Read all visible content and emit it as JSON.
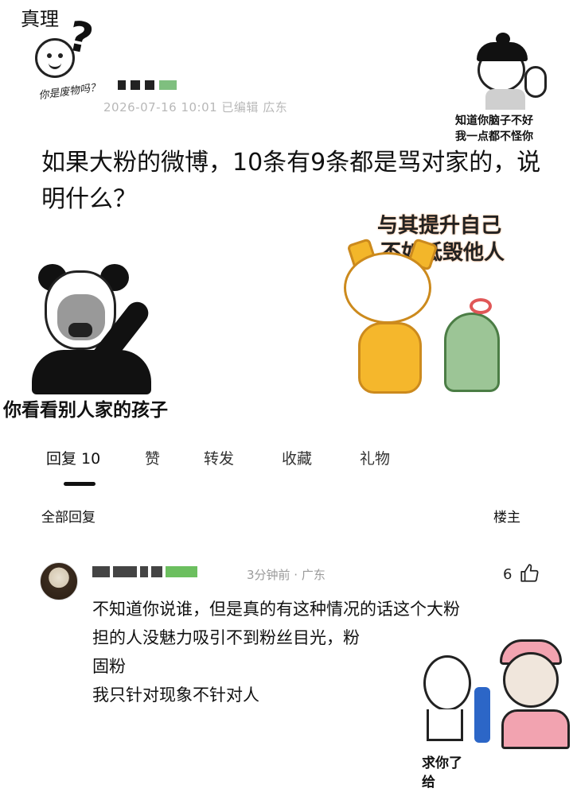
{
  "memes": {
    "top_left_title": "真理",
    "top_left_caption": "你是废物吗？",
    "top_right_caption": [
      "知道你脑子不好",
      "我一点都不怪你"
    ],
    "panda_caption": "你看看别人家的孩子",
    "cat_caption": [
      "与其提升自己",
      "不如诋毁他人"
    ],
    "bottom_right_caption": [
      "求你了",
      "给"
    ]
  },
  "post": {
    "meta": "2026-07-16 10:01 已编辑 広东",
    "body": "如果大粉的微博，10条有9条都是骂对家的，说明什么？"
  },
  "tabs": [
    {
      "label": "回复 10"
    },
    {
      "label": "赞"
    },
    {
      "label": "转发"
    },
    {
      "label": "收藏"
    },
    {
      "label": "礼物"
    }
  ],
  "filter": {
    "all_replies": "全部回复",
    "op": "楼主"
  },
  "comment": {
    "meta": "3分钟前 · 广东",
    "likes": "6",
    "lines": [
      "不知道你说谁，但是真的有这种情况的话这个大粉",
      "担的人没魅力吸引不到粉丝目光，粉",
      "固粉",
      "我只针对现象不针对人"
    ]
  },
  "colors": {
    "text": "#111111",
    "meta_gray": "#b8b8b8",
    "accent_black": "#111111"
  },
  "icons": {
    "like": "thumbs-up-icon"
  }
}
